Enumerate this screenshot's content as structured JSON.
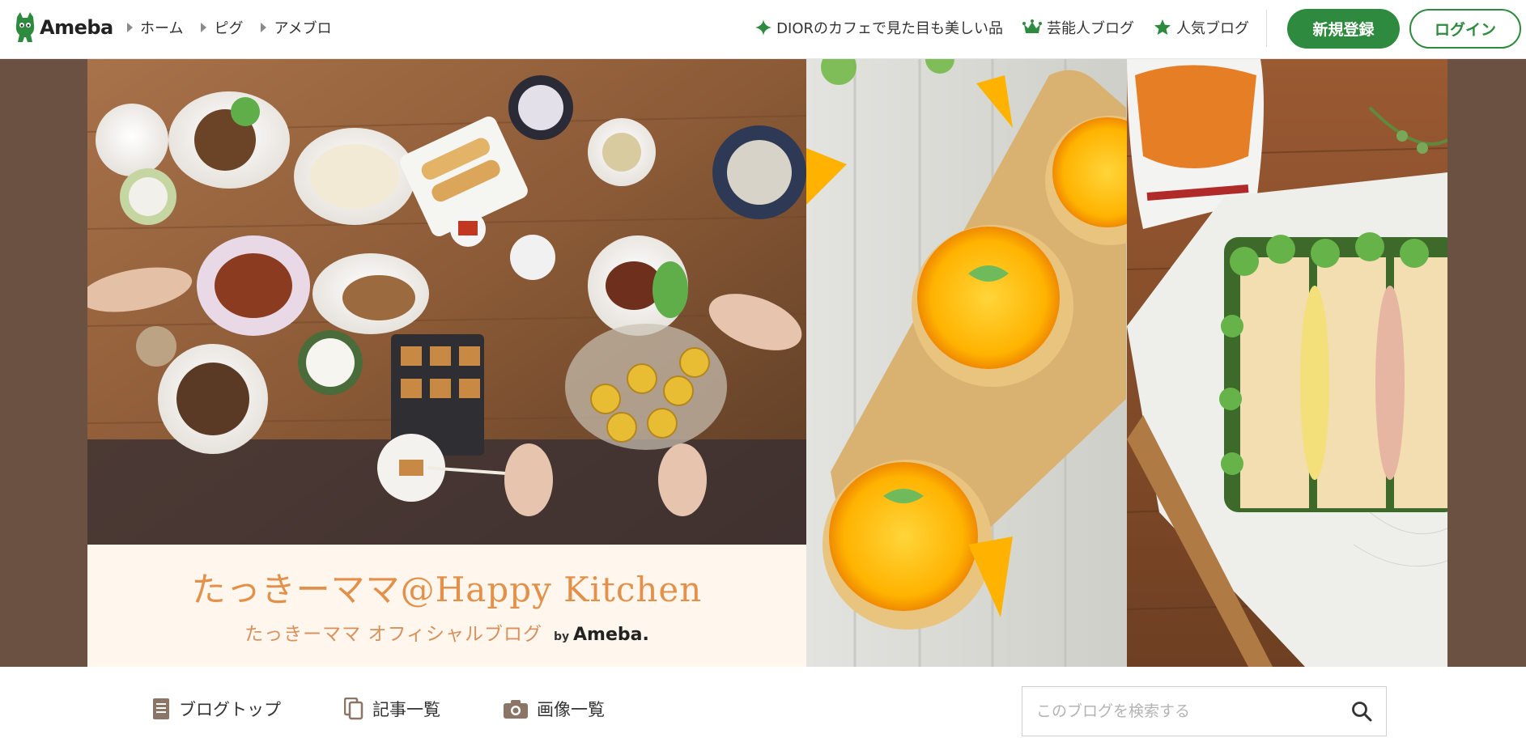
{
  "header": {
    "logo_text": "Ameba",
    "nav": [
      {
        "label": "ホーム"
      },
      {
        "label": "ピグ"
      },
      {
        "label": "アメブロ"
      }
    ],
    "promo_links": [
      {
        "label": "DIORのカフェで見た目も美しい品",
        "icon": "sparkle-icon"
      },
      {
        "label": "芸能人ブログ",
        "icon": "crown-icon"
      },
      {
        "label": "人気ブログ",
        "icon": "star-icon"
      }
    ],
    "register_label": "新規登録",
    "login_label": "ログイン"
  },
  "banner": {
    "title": "たっきーママ@Happy Kitchen",
    "subtitle": "たっきーママ オフィシャルブログ",
    "by_label": "by",
    "by_brand": "Ameba."
  },
  "blog_nav": {
    "items": [
      {
        "label": "ブログトップ",
        "icon": "document-icon"
      },
      {
        "label": "記事一覧",
        "icon": "copy-icon"
      },
      {
        "label": "画像一覧",
        "icon": "camera-icon"
      }
    ],
    "search_placeholder": "このブログを検索する",
    "search_value": ""
  },
  "colors": {
    "brand_green": "#2d8a3e",
    "banner_bg": "#6a5142",
    "title_orange": "#e3914a"
  }
}
